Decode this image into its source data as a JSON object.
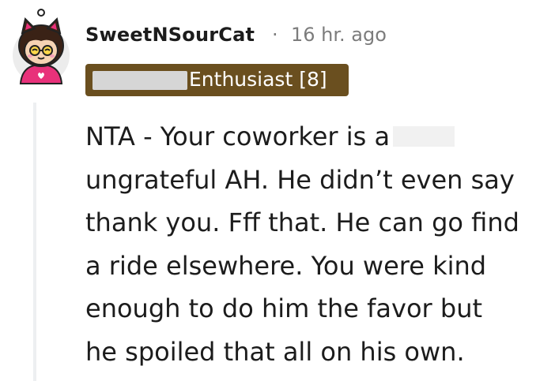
{
  "comment": {
    "username": "SweetNSourCat",
    "separator": "·",
    "timestamp": "16 hr. ago",
    "flair": "Enthusiast [8]",
    "body_lines": [
      "NTA - Your coworker is a",
      "ungrateful AH. He didn’t even say",
      "thank you. Fff that. He can go find",
      "a ride elsewhere. You were kind",
      "enough to do him the favor but",
      "he spoiled that all on his own."
    ]
  },
  "colors": {
    "flair_background": "#6a4f1f",
    "text": "#1c1c1c",
    "meta_text": "#7c7c7c",
    "avatar_accent": "#e8317a"
  },
  "icons": {
    "avatar": "snoo-avatar-cat-ears"
  }
}
